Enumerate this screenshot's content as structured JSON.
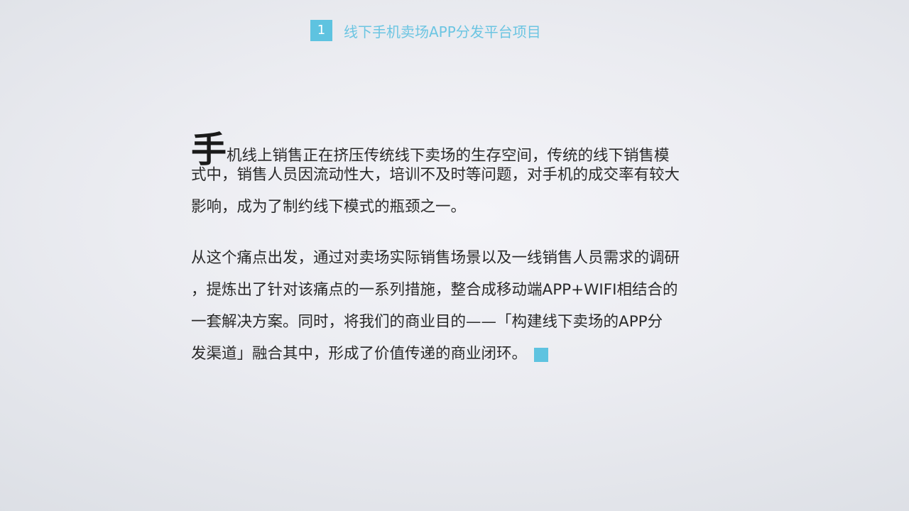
{
  "header": {
    "number": "1",
    "title": "线下手机卖场APP分发平台项目"
  },
  "paragraph1": {
    "dropcap": "手",
    "line1": "机线上销售正在挤压传统线下卖场的生存空间，传统的线下销售模",
    "line2": "式中，销售人员因流动性大，培训不及时等问题，对手机的成交率有较大",
    "line3": "影响，成为了制约线下模式的瓶颈之一。"
  },
  "paragraph2": {
    "line1": "从这个痛点出发，通过对卖场实际销售场景以及一线销售人员需求的调研",
    "line2": "，提炼出了针对该痛点的一系列措施，整合成移动端APP+WIFI相结合的",
    "line3": "一套解决方案。同时，将我们的商业目的——「构建线下卖场的APP分",
    "line4": "发渠道」融合其中，形成了价值传递的商业闭环。"
  },
  "colors": {
    "accent": "#5ec3e0",
    "title_text": "#6cc5e2",
    "body_text": "#2a2a2a"
  }
}
